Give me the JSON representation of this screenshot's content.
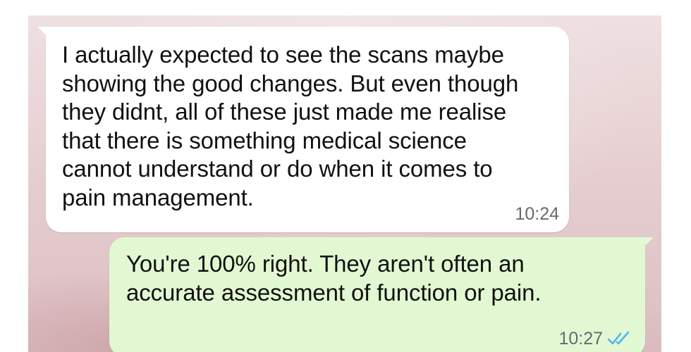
{
  "messages": [
    {
      "direction": "incoming",
      "text": "I actually expected to see the scans maybe\nshowing the good changes. But even though\nthey didnt, all of these just made me realise\nthat there is something medical science\ncannot understand or do when it comes to\npain management.",
      "time": "10:24"
    },
    {
      "direction": "outgoing",
      "text": "You're 100% right. They aren't often an\naccurate assessment of function or pain.",
      "time": "10:27",
      "status_icon": "double-check-read-icon",
      "status_color": "#4fb6ec"
    }
  ],
  "colors": {
    "incoming_bubble": "#ffffff",
    "outgoing_bubble": "#e2f8d2",
    "text": "#111111",
    "timestamp": "#666b6e"
  }
}
